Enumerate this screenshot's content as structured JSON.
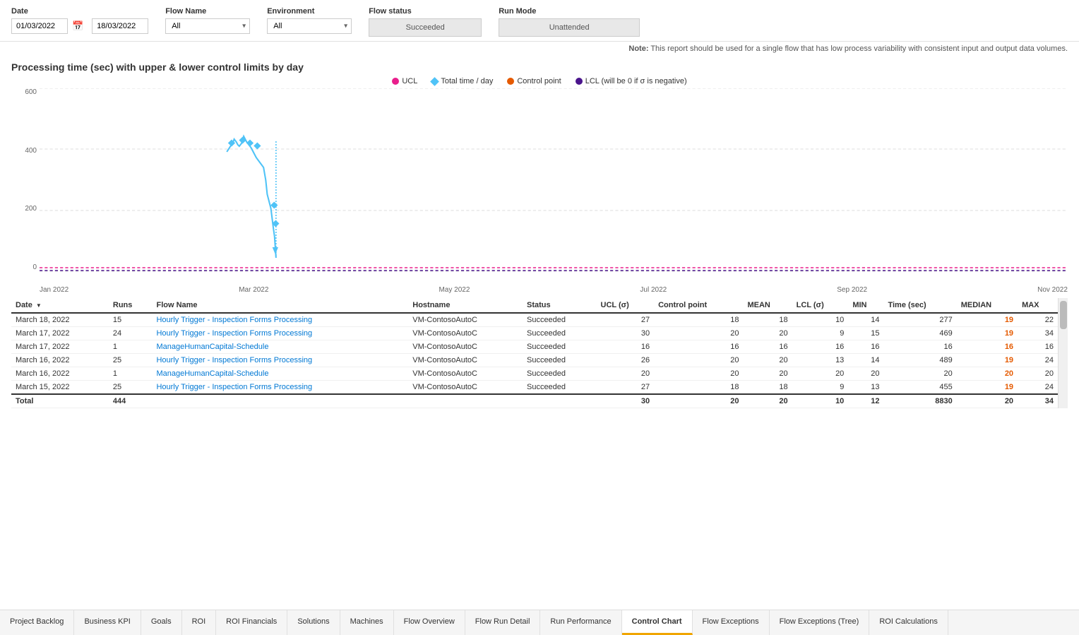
{
  "filters": {
    "date_label": "Date",
    "date_from": "01/03/2022",
    "date_to": "18/03/2022",
    "calendar_icon": "📅",
    "flow_name_label": "Flow Name",
    "flow_name_value": "All",
    "environment_label": "Environment",
    "environment_value": "All",
    "flow_status_label": "Flow status",
    "flow_status_value": "Succeeded",
    "run_mode_label": "Run Mode",
    "run_mode_value": "Unattended"
  },
  "note": {
    "prefix": "Note:",
    "text": " This report should be used for a single flow that has low process variability with consistent input and output data volumes."
  },
  "chart": {
    "title": "Processing time (sec) with upper & lower control limits by day",
    "legend": [
      {
        "label": "UCL",
        "color": "#e91e8c",
        "type": "dot"
      },
      {
        "label": "Total time / day",
        "color": "#4fc3f7",
        "type": "diamond"
      },
      {
        "label": "Control point",
        "color": "#e55a00",
        "type": "dot"
      },
      {
        "label": "LCL (will be 0 if σ is negative)",
        "color": "#4a148c",
        "type": "dot"
      }
    ],
    "y_labels": [
      "600",
      "400",
      "200",
      "0"
    ],
    "x_labels": [
      "Jan 2022",
      "Mar 2022",
      "May 2022",
      "Jul 2022",
      "Sep 2022",
      "Nov 2022"
    ]
  },
  "table": {
    "columns": [
      {
        "key": "date",
        "label": "Date",
        "sortable": true
      },
      {
        "key": "runs",
        "label": "Runs"
      },
      {
        "key": "flow_name",
        "label": "Flow Name"
      },
      {
        "key": "hostname",
        "label": "Hostname"
      },
      {
        "key": "status",
        "label": "Status"
      },
      {
        "key": "ucl",
        "label": "UCL (σ)"
      },
      {
        "key": "control_point",
        "label": "Control point"
      },
      {
        "key": "mean",
        "label": "MEAN"
      },
      {
        "key": "lcl",
        "label": "LCL (σ)"
      },
      {
        "key": "min",
        "label": "MIN"
      },
      {
        "key": "time_sec",
        "label": "Time (sec)"
      },
      {
        "key": "median",
        "label": "MEDIAN"
      },
      {
        "key": "max",
        "label": "MAX"
      }
    ],
    "rows": [
      {
        "date": "March 18, 2022",
        "runs": "15",
        "flow_name": "Hourly Trigger - Inspection Forms Processing",
        "hostname": "VM-ContosoAutoC",
        "status": "Succeeded",
        "ucl": "27",
        "control_point": "18",
        "mean": "18",
        "lcl": "10",
        "min": "14",
        "time_sec": "277",
        "median": "19",
        "max": "22"
      },
      {
        "date": "March 17, 2022",
        "runs": "24",
        "flow_name": "Hourly Trigger - Inspection Forms Processing",
        "hostname": "VM-ContosoAutoC",
        "status": "Succeeded",
        "ucl": "30",
        "control_point": "20",
        "mean": "20",
        "lcl": "9",
        "min": "15",
        "time_sec": "469",
        "median": "19",
        "max": "34"
      },
      {
        "date": "March 17, 2022",
        "runs": "1",
        "flow_name": "ManageHumanCapital-Schedule",
        "hostname": "VM-ContosoAutoC",
        "status": "Succeeded",
        "ucl": "16",
        "control_point": "16",
        "mean": "16",
        "lcl": "16",
        "min": "16",
        "time_sec": "16",
        "median": "16",
        "max": "16"
      },
      {
        "date": "March 16, 2022",
        "runs": "25",
        "flow_name": "Hourly Trigger - Inspection Forms Processing",
        "hostname": "VM-ContosoAutoC",
        "status": "Succeeded",
        "ucl": "26",
        "control_point": "20",
        "mean": "20",
        "lcl": "13",
        "min": "14",
        "time_sec": "489",
        "median": "19",
        "max": "24"
      },
      {
        "date": "March 16, 2022",
        "runs": "1",
        "flow_name": "ManageHumanCapital-Schedule",
        "hostname": "VM-ContosoAutoC",
        "status": "Succeeded",
        "ucl": "20",
        "control_point": "20",
        "mean": "20",
        "lcl": "20",
        "min": "20",
        "time_sec": "20",
        "median": "20",
        "max": "20"
      },
      {
        "date": "March 15, 2022",
        "runs": "25",
        "flow_name": "Hourly Trigger - Inspection Forms Processing",
        "hostname": "VM-ContosoAutoC",
        "status": "Succeeded",
        "ucl": "27",
        "control_point": "18",
        "mean": "18",
        "lcl": "9",
        "min": "13",
        "time_sec": "455",
        "median": "19",
        "max": "24"
      }
    ],
    "total_row": {
      "label": "Total",
      "runs": "444",
      "ucl": "30",
      "control_point": "20",
      "mean": "20",
      "lcl": "10",
      "min": "12",
      "time_sec": "8830",
      "median": "20",
      "max": "34"
    }
  },
  "tabs": [
    {
      "label": "Project Backlog",
      "active": false
    },
    {
      "label": "Business KPI",
      "active": false
    },
    {
      "label": "Goals",
      "active": false
    },
    {
      "label": "ROI",
      "active": false
    },
    {
      "label": "ROI Financials",
      "active": false
    },
    {
      "label": "Solutions",
      "active": false
    },
    {
      "label": "Machines",
      "active": false
    },
    {
      "label": "Flow Overview",
      "active": false
    },
    {
      "label": "Flow Run Detail",
      "active": false
    },
    {
      "label": "Run Performance",
      "active": false
    },
    {
      "label": "Control Chart",
      "active": true
    },
    {
      "label": "Flow Exceptions",
      "active": false
    },
    {
      "label": "Flow Exceptions (Tree)",
      "active": false
    },
    {
      "label": "ROI Calculations",
      "active": false
    }
  ]
}
